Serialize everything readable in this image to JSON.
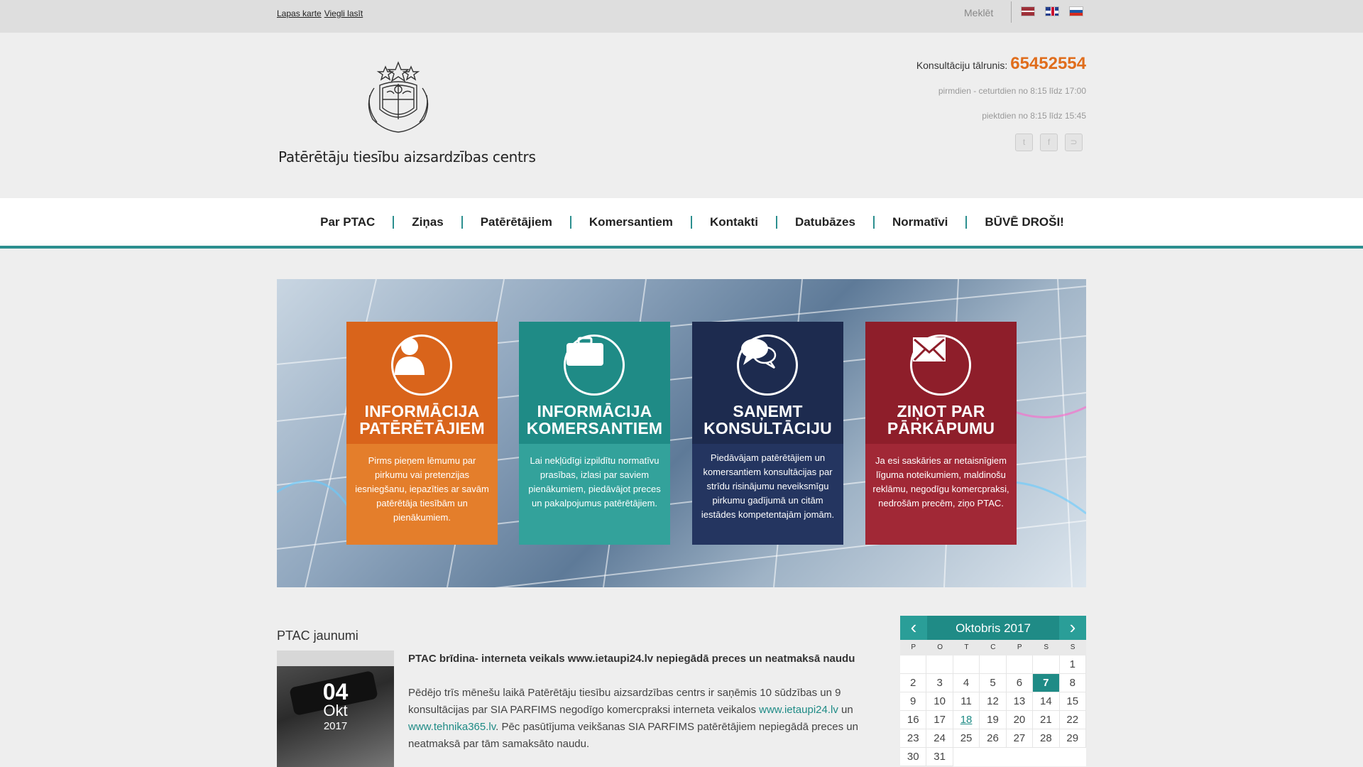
{
  "topbar": {
    "sitemap_link": "Lapas karte",
    "easy_read_link": "Viegli lasīt",
    "search_label": "Meklēt",
    "languages": [
      "lv",
      "en",
      "ru"
    ]
  },
  "header": {
    "org_name": "Patērētāju tiesību aizsardzības centrs",
    "phone_label": "Konsultāciju tālrunis:",
    "phone_number": "65452554",
    "hours_weekdays": "pirmdien - ceturtdien no 8:15 līdz 17:00",
    "hours_friday": "piektdien no 8:15 līdz 15:45",
    "social_icons": [
      "twitter-icon",
      "facebook-icon",
      "rss-icon"
    ]
  },
  "nav": {
    "items": [
      "Par PTAC",
      "Ziņas",
      "Patērētājiem",
      "Komersantiem",
      "Kontakti",
      "Datubāzes",
      "Normatīvi",
      "BŪVĒ DROŠI!"
    ]
  },
  "cards": [
    {
      "icon": "user-icon",
      "title_line1": "INFORMĀCIJA",
      "title_line2": "PATĒRĒTĀJIEM",
      "description": "Pirms pieņem lēmumu par pirkumu vai pretenzijas iesniegšanu, iepazīties ar savām patērētāja tiesībām un pienākumiem.",
      "color": "#d9641b"
    },
    {
      "icon": "briefcase-icon",
      "title_line1": "INFORMĀCIJA",
      "title_line2": "KOMERSANTIEM",
      "description": "Lai nekļūdīgi izpildītu normatīvu prasības, izlasi par saviem pienākumiem, piedāvājot preces un pakalpojumus patērētājiem.",
      "color": "#1f8b86"
    },
    {
      "icon": "chat-bubbles-icon",
      "title_line1": "SAŅEMT",
      "title_line2": "KONSULTĀCIJU",
      "description": "Piedāvājam patērētājiem un komersantiem konsultācijas par strīdu risinājumu neveiksmīgu pirkumu gadījumā un citām iestādes kompetentajām jomām.",
      "color": "#1d2b4f"
    },
    {
      "icon": "envelope-icon",
      "title_line1": "ZIŅOT PAR",
      "title_line2": "PĀRKĀPUMU",
      "description": "Ja esi saskāries ar netaisnīgiem līguma noteikumiem, maldinošu reklāmu, negodīgu komercpraksi, nedrošām precēm, ziņo PTAC.",
      "color": "#8e1e2a"
    }
  ],
  "news": {
    "heading": "PTAC jaunumi",
    "date_day": "04",
    "date_month": "Okt",
    "date_year": "2017",
    "title": "PTAC brīdina- interneta veikals www.ietaupi24.lv nepiegādā preces un neatmaksā naudu",
    "body_part1": "Pēdējo trīs mēnešu laikā Patērētāju tiesību aizsardzības centrs ir saņēmis 10 sūdzības un 9 konsultācijas par SIA PARFIMS negodīgo komercpraksi interneta veikalos ",
    "link1": "www.ietaupi24.lv",
    "body_part2": " un ",
    "link2": "www.tehnika365.lv",
    "body_part3": ". Pēc pasūtījuma veikšanas SIA PARFIMS patērētājiem nepiegādā preces un neatmaksā par tām samaksāto naudu."
  },
  "calendar": {
    "title": "Oktobris 2017",
    "weekdays": [
      "P",
      "O",
      "T",
      "C",
      "P",
      "S",
      "S"
    ],
    "leading_blanks": 6,
    "days_in_month": 31,
    "today": 7,
    "event_days": [
      18
    ],
    "accent": "#1f8b86"
  }
}
